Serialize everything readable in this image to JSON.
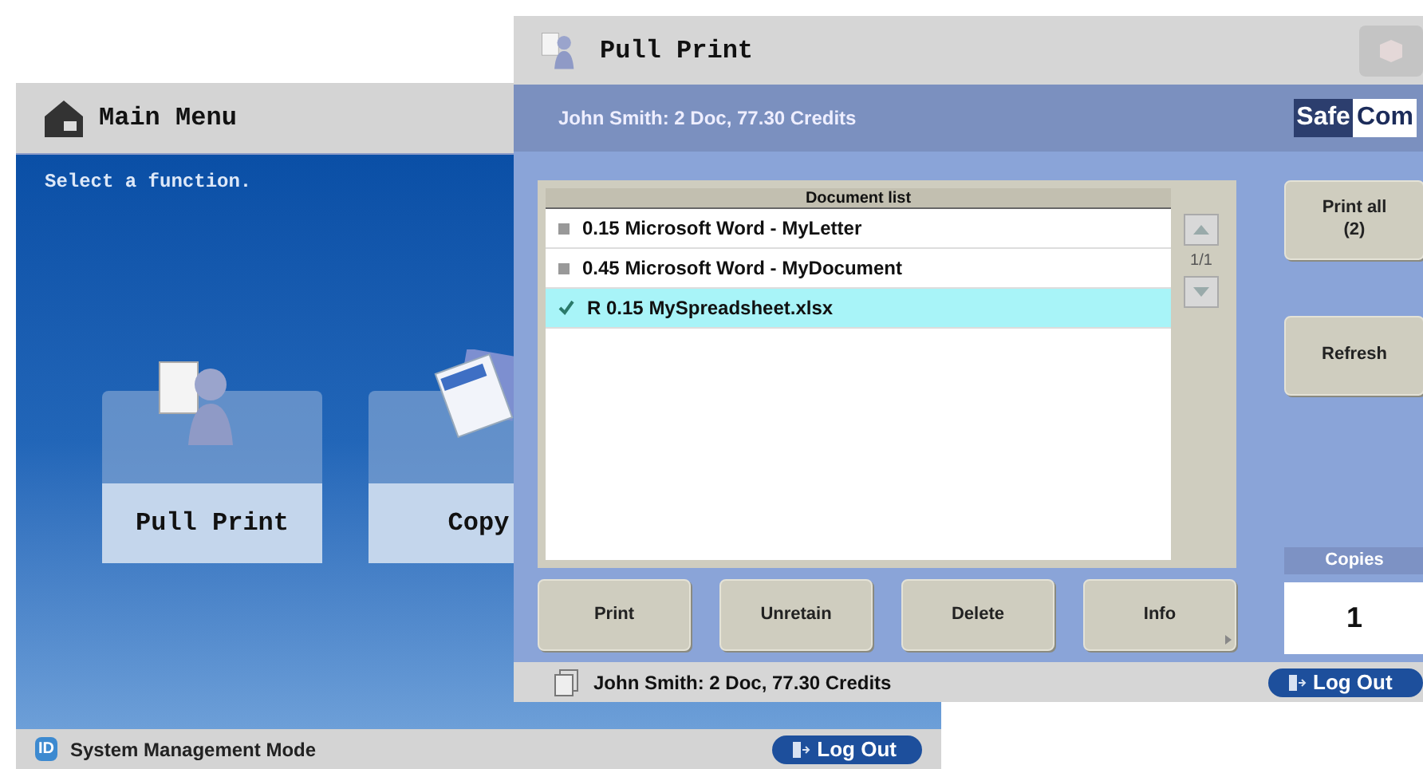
{
  "main_menu": {
    "title": "Main Menu",
    "prompt": "Select a function.",
    "tiles": [
      {
        "label": "Pull Print",
        "kind": "person"
      },
      {
        "label": "Copy",
        "kind": "copy"
      }
    ],
    "status_bar": {
      "mode_badge": "ID",
      "mode": "System Management Mode",
      "logout": "Log Out"
    }
  },
  "pull_print": {
    "title": "Pull Print",
    "user_info": "John Smith: 2 Doc, 77.30 Credits",
    "logo": {
      "part_1": "Safe",
      "part_2": "Com"
    },
    "document_list": {
      "heading": "Document list",
      "page": "1/1",
      "rows": [
        {
          "label": "0.15 Microsoft Word - MyLetter",
          "selected": false
        },
        {
          "label": "0.45 Microsoft Word - MyDocument",
          "selected": false
        },
        {
          "label": "R 0.15 MySpreadsheet.xlsx",
          "selected": true
        }
      ]
    },
    "actions": [
      "Print",
      "Unretain",
      "Delete",
      "Info"
    ],
    "side_buttons": [
      {
        "label": "Print all",
        "sub": "(2)"
      },
      {
        "label": "Refresh"
      }
    ],
    "copies": {
      "label": "Copies",
      "value": "1"
    },
    "status_bar": {
      "text": "John Smith: 2 Doc, 77.30 Credits",
      "logout": "Log Out"
    }
  }
}
